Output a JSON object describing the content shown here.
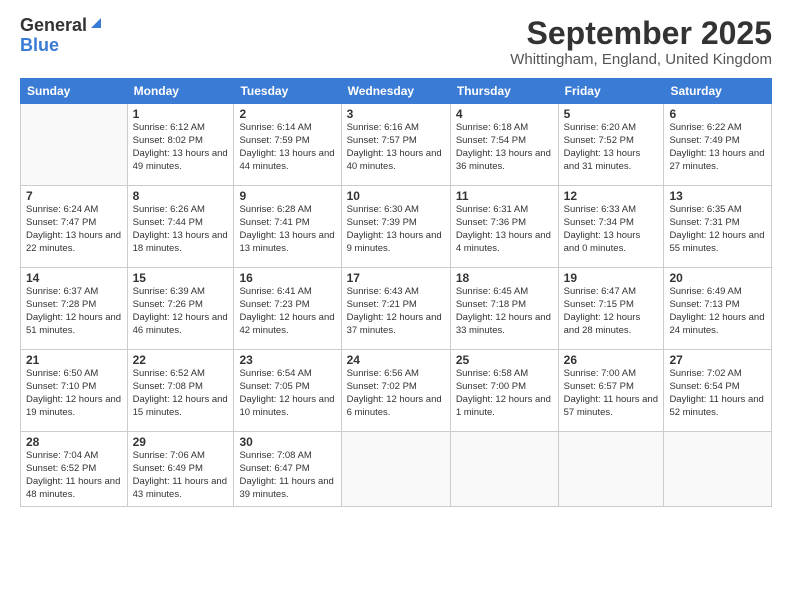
{
  "logo": {
    "general": "General",
    "blue": "Blue",
    "tagline": ""
  },
  "title": "September 2025",
  "location": "Whittingham, England, United Kingdom",
  "weekdays": [
    "Sunday",
    "Monday",
    "Tuesday",
    "Wednesday",
    "Thursday",
    "Friday",
    "Saturday"
  ],
  "weeks": [
    [
      {
        "day": "",
        "sunrise": "",
        "sunset": "",
        "daylight": ""
      },
      {
        "day": "1",
        "sunrise": "Sunrise: 6:12 AM",
        "sunset": "Sunset: 8:02 PM",
        "daylight": "Daylight: 13 hours and 49 minutes."
      },
      {
        "day": "2",
        "sunrise": "Sunrise: 6:14 AM",
        "sunset": "Sunset: 7:59 PM",
        "daylight": "Daylight: 13 hours and 44 minutes."
      },
      {
        "day": "3",
        "sunrise": "Sunrise: 6:16 AM",
        "sunset": "Sunset: 7:57 PM",
        "daylight": "Daylight: 13 hours and 40 minutes."
      },
      {
        "day": "4",
        "sunrise": "Sunrise: 6:18 AM",
        "sunset": "Sunset: 7:54 PM",
        "daylight": "Daylight: 13 hours and 36 minutes."
      },
      {
        "day": "5",
        "sunrise": "Sunrise: 6:20 AM",
        "sunset": "Sunset: 7:52 PM",
        "daylight": "Daylight: 13 hours and 31 minutes."
      },
      {
        "day": "6",
        "sunrise": "Sunrise: 6:22 AM",
        "sunset": "Sunset: 7:49 PM",
        "daylight": "Daylight: 13 hours and 27 minutes."
      }
    ],
    [
      {
        "day": "7",
        "sunrise": "Sunrise: 6:24 AM",
        "sunset": "Sunset: 7:47 PM",
        "daylight": "Daylight: 13 hours and 22 minutes."
      },
      {
        "day": "8",
        "sunrise": "Sunrise: 6:26 AM",
        "sunset": "Sunset: 7:44 PM",
        "daylight": "Daylight: 13 hours and 18 minutes."
      },
      {
        "day": "9",
        "sunrise": "Sunrise: 6:28 AM",
        "sunset": "Sunset: 7:41 PM",
        "daylight": "Daylight: 13 hours and 13 minutes."
      },
      {
        "day": "10",
        "sunrise": "Sunrise: 6:30 AM",
        "sunset": "Sunset: 7:39 PM",
        "daylight": "Daylight: 13 hours and 9 minutes."
      },
      {
        "day": "11",
        "sunrise": "Sunrise: 6:31 AM",
        "sunset": "Sunset: 7:36 PM",
        "daylight": "Daylight: 13 hours and 4 minutes."
      },
      {
        "day": "12",
        "sunrise": "Sunrise: 6:33 AM",
        "sunset": "Sunset: 7:34 PM",
        "daylight": "Daylight: 13 hours and 0 minutes."
      },
      {
        "day": "13",
        "sunrise": "Sunrise: 6:35 AM",
        "sunset": "Sunset: 7:31 PM",
        "daylight": "Daylight: 12 hours and 55 minutes."
      }
    ],
    [
      {
        "day": "14",
        "sunrise": "Sunrise: 6:37 AM",
        "sunset": "Sunset: 7:28 PM",
        "daylight": "Daylight: 12 hours and 51 minutes."
      },
      {
        "day": "15",
        "sunrise": "Sunrise: 6:39 AM",
        "sunset": "Sunset: 7:26 PM",
        "daylight": "Daylight: 12 hours and 46 minutes."
      },
      {
        "day": "16",
        "sunrise": "Sunrise: 6:41 AM",
        "sunset": "Sunset: 7:23 PM",
        "daylight": "Daylight: 12 hours and 42 minutes."
      },
      {
        "day": "17",
        "sunrise": "Sunrise: 6:43 AM",
        "sunset": "Sunset: 7:21 PM",
        "daylight": "Daylight: 12 hours and 37 minutes."
      },
      {
        "day": "18",
        "sunrise": "Sunrise: 6:45 AM",
        "sunset": "Sunset: 7:18 PM",
        "daylight": "Daylight: 12 hours and 33 minutes."
      },
      {
        "day": "19",
        "sunrise": "Sunrise: 6:47 AM",
        "sunset": "Sunset: 7:15 PM",
        "daylight": "Daylight: 12 hours and 28 minutes."
      },
      {
        "day": "20",
        "sunrise": "Sunrise: 6:49 AM",
        "sunset": "Sunset: 7:13 PM",
        "daylight": "Daylight: 12 hours and 24 minutes."
      }
    ],
    [
      {
        "day": "21",
        "sunrise": "Sunrise: 6:50 AM",
        "sunset": "Sunset: 7:10 PM",
        "daylight": "Daylight: 12 hours and 19 minutes."
      },
      {
        "day": "22",
        "sunrise": "Sunrise: 6:52 AM",
        "sunset": "Sunset: 7:08 PM",
        "daylight": "Daylight: 12 hours and 15 minutes."
      },
      {
        "day": "23",
        "sunrise": "Sunrise: 6:54 AM",
        "sunset": "Sunset: 7:05 PM",
        "daylight": "Daylight: 12 hours and 10 minutes."
      },
      {
        "day": "24",
        "sunrise": "Sunrise: 6:56 AM",
        "sunset": "Sunset: 7:02 PM",
        "daylight": "Daylight: 12 hours and 6 minutes."
      },
      {
        "day": "25",
        "sunrise": "Sunrise: 6:58 AM",
        "sunset": "Sunset: 7:00 PM",
        "daylight": "Daylight: 12 hours and 1 minute."
      },
      {
        "day": "26",
        "sunrise": "Sunrise: 7:00 AM",
        "sunset": "Sunset: 6:57 PM",
        "daylight": "Daylight: 11 hours and 57 minutes."
      },
      {
        "day": "27",
        "sunrise": "Sunrise: 7:02 AM",
        "sunset": "Sunset: 6:54 PM",
        "daylight": "Daylight: 11 hours and 52 minutes."
      }
    ],
    [
      {
        "day": "28",
        "sunrise": "Sunrise: 7:04 AM",
        "sunset": "Sunset: 6:52 PM",
        "daylight": "Daylight: 11 hours and 48 minutes."
      },
      {
        "day": "29",
        "sunrise": "Sunrise: 7:06 AM",
        "sunset": "Sunset: 6:49 PM",
        "daylight": "Daylight: 11 hours and 43 minutes."
      },
      {
        "day": "30",
        "sunrise": "Sunrise: 7:08 AM",
        "sunset": "Sunset: 6:47 PM",
        "daylight": "Daylight: 11 hours and 39 minutes."
      },
      {
        "day": "",
        "sunrise": "",
        "sunset": "",
        "daylight": ""
      },
      {
        "day": "",
        "sunrise": "",
        "sunset": "",
        "daylight": ""
      },
      {
        "day": "",
        "sunrise": "",
        "sunset": "",
        "daylight": ""
      },
      {
        "day": "",
        "sunrise": "",
        "sunset": "",
        "daylight": ""
      }
    ]
  ]
}
